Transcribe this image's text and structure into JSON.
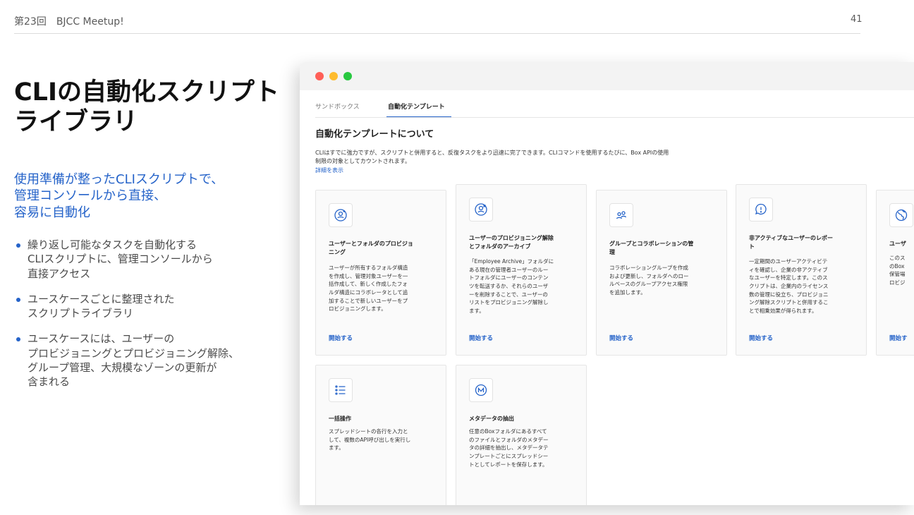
{
  "slide": {
    "header": "第23回　BJCC Meetup!",
    "page_number": "41"
  },
  "title_lines": [
    "CLIの自動化スクリプト",
    "ライブラリ"
  ],
  "subtitle_lines": [
    "使用準備が整ったCLIスクリプトで、",
    "管理コンソールから直接、",
    "容易に自動化"
  ],
  "bullets": [
    {
      "lines": [
        "繰り返し可能なタスクを自動化する",
        "CLIスクリプトに、管理コンソールから",
        "直接アクセス"
      ]
    },
    {
      "lines": [
        "ユースケースごとに整理された",
        "スクリプトライブラリ"
      ]
    },
    {
      "lines": [
        "ユースケースには、ユーザーの",
        "プロビジョニングとプロビジョニング解除、",
        "グループ管理、大規模なゾーンの更新が",
        "含まれる"
      ]
    }
  ],
  "screenshot": {
    "tabs": [
      "サンドボックス",
      "自動化テンプレート"
    ],
    "active_tab": "自動化テンプレート",
    "heading": "自動化テンプレートについて",
    "description_lines": [
      "CLIはすでに強力ですが、スクリプトと併用すると、反復タスクをより迅速に完了できます。CLIコマンドを使用するたびに、Box APIの使用",
      "制限の対象としてカウントされます。"
    ],
    "details_link": "詳細を表示",
    "colors": {
      "accent": "#2563c9",
      "dot_red": "#ff5f57",
      "dot_yellow": "#febc2e",
      "dot_green": "#28c840"
    },
    "cards": [
      {
        "icon": "user-plus-icon",
        "title_lines": [
          "ユーザーとフォルダのプロビジョ",
          "ニング"
        ],
        "desc_lines": [
          "ユーザーが所有するフォルダ構造",
          "を作成し、管理対象ユーザーを一",
          "括作成して、新しく作成したフォ",
          "ルダ構造にコラボレータとして追",
          "加することで新しいユーザーをプ",
          "ロビジョニングします。"
        ],
        "action": "開始する"
      },
      {
        "icon": "user-remove-icon",
        "title_lines": [
          "ユーザーのプロビジョニング解除",
          "とフォルダのアーカイブ"
        ],
        "desc_lines": [
          "「Employee Archive」フォルダに",
          "ある現在の管理者ユーザーのルー",
          "トフォルダにユーザーのコンテン",
          "ツを転送するか、それらのユーザ",
          "ーを削除することで、ユーザーの",
          "リストをプロビジョニング解除し",
          "ます。"
        ],
        "action": "開始する"
      },
      {
        "icon": "group-icon",
        "title_lines": [
          "グループとコラボレーションの管",
          "理"
        ],
        "desc_lines": [
          "コラボレーショングループを作成",
          "および更新し、フォルダへのロー",
          "ルベースのグループアクセス権限",
          "を追加します。"
        ],
        "action": "開始する"
      },
      {
        "icon": "alert-icon",
        "title_lines": [
          "非アクティブなユーザーのレポー",
          "ト"
        ],
        "desc_lines": [
          "一定期間のユーザーアクティビテ",
          "ィを確認し、企業の非アクティブ",
          "なユーザーを特定します。このス",
          "クリプトは、企業内のライセンス",
          "数の管理に役立ち、プロビジョニ",
          "ング解除スクリプトと併用するこ",
          "とで相乗効果が得られます。"
        ],
        "action": "開始する"
      },
      {
        "icon": "globe-icon",
        "title_lines": [
          "ユーザ"
        ],
        "desc_lines": [
          "このス",
          "のBox",
          "保管場",
          "ロビジ"
        ],
        "action": "開始す"
      },
      {
        "icon": "list-icon",
        "title_lines": [
          "一括操作"
        ],
        "desc_lines": [
          "スプレッドシートの各行を入力と",
          "して、複数のAPI呼び出しを実行し",
          "ます。"
        ],
        "action": ""
      },
      {
        "icon": "metadata-icon",
        "title_lines": [
          "メタデータの抽出"
        ],
        "desc_lines": [
          "任意のBoxフォルダにあるすべて",
          "のファイルとフォルダのメタデー",
          "タの詳細を抽出し、メタデータテ",
          "ンプレートごとにスプレッドシー",
          "トとしてレポートを保存します。"
        ],
        "action": ""
      }
    ]
  }
}
